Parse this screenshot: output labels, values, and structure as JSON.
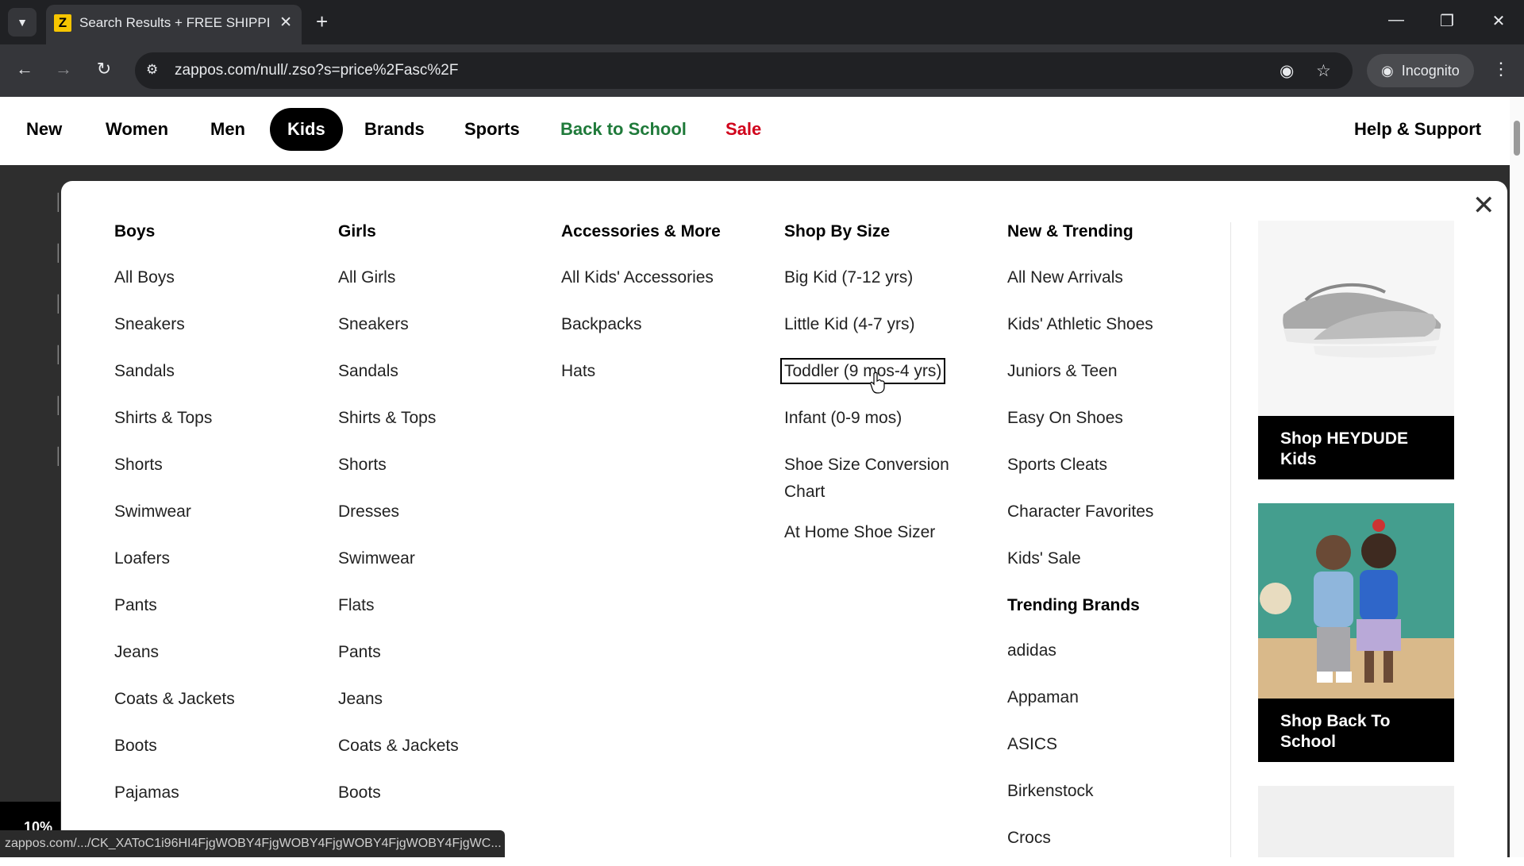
{
  "browser": {
    "tab_title": "Search Results + FREE SHIPPING",
    "favicon_letter": "Z",
    "url": "zappos.com/null/.zso?s=price%2Fasc%2F",
    "incognito_label": "Incognito",
    "status_url": "zappos.com/.../CK_XAToC1i96HI4FjgWOBY4FjgWOBY4FjgWOBY4FjgWOBY4FjgWC..."
  },
  "nav": {
    "items": [
      {
        "label": "New"
      },
      {
        "label": "Women"
      },
      {
        "label": "Men"
      },
      {
        "label": "Kids"
      },
      {
        "label": "Brands"
      },
      {
        "label": "Sports"
      },
      {
        "label": "Back to School"
      },
      {
        "label": "Sale"
      }
    ],
    "help": "Help & Support"
  },
  "menu": {
    "boys": {
      "heading": "Boys",
      "items": [
        "All Boys",
        "Sneakers",
        "Sandals",
        "Shirts & Tops",
        "Shorts",
        "Swimwear",
        "Loafers",
        "Pants",
        "Jeans",
        "Coats & Jackets",
        "Boots",
        "Pajamas"
      ]
    },
    "girls": {
      "heading": "Girls",
      "items": [
        "All Girls",
        "Sneakers",
        "Sandals",
        "Shirts & Tops",
        "Shorts",
        "Dresses",
        "Swimwear",
        "Flats",
        "Pants",
        "Jeans",
        "Coats & Jackets",
        "Boots"
      ]
    },
    "accessories": {
      "heading": "Accessories & More",
      "items": [
        "All Kids' Accessories",
        "Backpacks",
        "Hats"
      ]
    },
    "size": {
      "heading": "Shop By Size",
      "items": [
        "Big Kid (7-12 yrs)",
        "Little Kid (4-7 yrs)",
        "Toddler (9 mos-4 yrs)",
        "Infant (0-9 mos)",
        "Shoe Size Conversion Chart",
        "At Home Shoe Sizer"
      ]
    },
    "trending": {
      "heading": "New & Trending",
      "items": [
        "All New Arrivals",
        "Kids' Athletic Shoes",
        "Juniors & Teen",
        "Easy On Shoes",
        "Sports Cleats",
        "Character Favorites",
        "Kids' Sale"
      ],
      "brands_heading": "Trending Brands",
      "brands": [
        "adidas",
        "Appaman",
        "ASICS",
        "Birkenstock",
        "Crocs"
      ]
    },
    "promos": [
      {
        "label": "Shop HEYDUDE Kids"
      },
      {
        "label": "Shop Back To School"
      }
    ]
  },
  "promo_badge": "10%"
}
